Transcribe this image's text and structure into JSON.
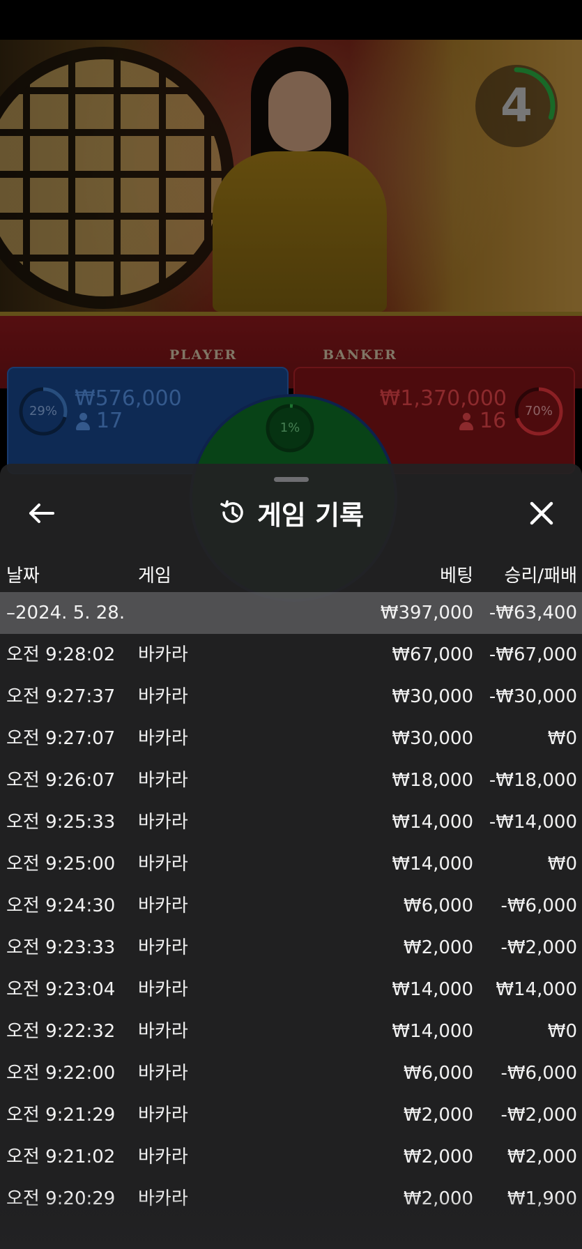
{
  "live_table": {
    "countdown": "4",
    "countdown_fraction": 0.3,
    "table_labels": {
      "player": "PLAYER",
      "banker": "BANKER"
    },
    "player_panel": {
      "percent": "29%",
      "percent_value": 0.29,
      "amount": "₩576,000",
      "players": "17",
      "color": "#2e6cc8"
    },
    "banker_panel": {
      "percent": "70%",
      "percent_value": 0.7,
      "amount": "₩1,370,000",
      "players": "16",
      "color": "#d0242b"
    },
    "tie": {
      "percent": "1%",
      "percent_value": 0.01,
      "color": "#1fa33a"
    }
  },
  "history_sheet": {
    "title": "게임 기록",
    "icons": {
      "back": "arrow-left-icon",
      "history": "history-icon",
      "close": "close-icon"
    },
    "columns": {
      "date": "날짜",
      "game": "게임",
      "bet": "베팅",
      "result": "승리/패배"
    },
    "summary": {
      "date": "–2024. 5. 28.",
      "bet": "₩397,000",
      "result": "-₩63,400"
    },
    "rows": [
      {
        "time": "오전 9:28:02",
        "game": "바카라",
        "bet": "₩67,000",
        "result": "-₩67,000"
      },
      {
        "time": "오전 9:27:37",
        "game": "바카라",
        "bet": "₩30,000",
        "result": "-₩30,000"
      },
      {
        "time": "오전 9:27:07",
        "game": "바카라",
        "bet": "₩30,000",
        "result": "₩0"
      },
      {
        "time": "오전 9:26:07",
        "game": "바카라",
        "bet": "₩18,000",
        "result": "-₩18,000"
      },
      {
        "time": "오전 9:25:33",
        "game": "바카라",
        "bet": "₩14,000",
        "result": "-₩14,000"
      },
      {
        "time": "오전 9:25:00",
        "game": "바카라",
        "bet": "₩14,000",
        "result": "₩0"
      },
      {
        "time": "오전 9:24:30",
        "game": "바카라",
        "bet": "₩6,000",
        "result": "-₩6,000"
      },
      {
        "time": "오전 9:23:33",
        "game": "바카라",
        "bet": "₩2,000",
        "result": "-₩2,000"
      },
      {
        "time": "오전 9:23:04",
        "game": "바카라",
        "bet": "₩14,000",
        "result": "₩14,000"
      },
      {
        "time": "오전 9:22:32",
        "game": "바카라",
        "bet": "₩14,000",
        "result": "₩0"
      },
      {
        "time": "오전 9:22:00",
        "game": "바카라",
        "bet": "₩6,000",
        "result": "-₩6,000"
      },
      {
        "time": "오전 9:21:29",
        "game": "바카라",
        "bet": "₩2,000",
        "result": "-₩2,000"
      },
      {
        "time": "오전 9:21:02",
        "game": "바카라",
        "bet": "₩2,000",
        "result": "₩2,000"
      },
      {
        "time": "오전 9:20:29",
        "game": "바카라",
        "bet": "₩2,000",
        "result": "₩1,900"
      }
    ]
  }
}
